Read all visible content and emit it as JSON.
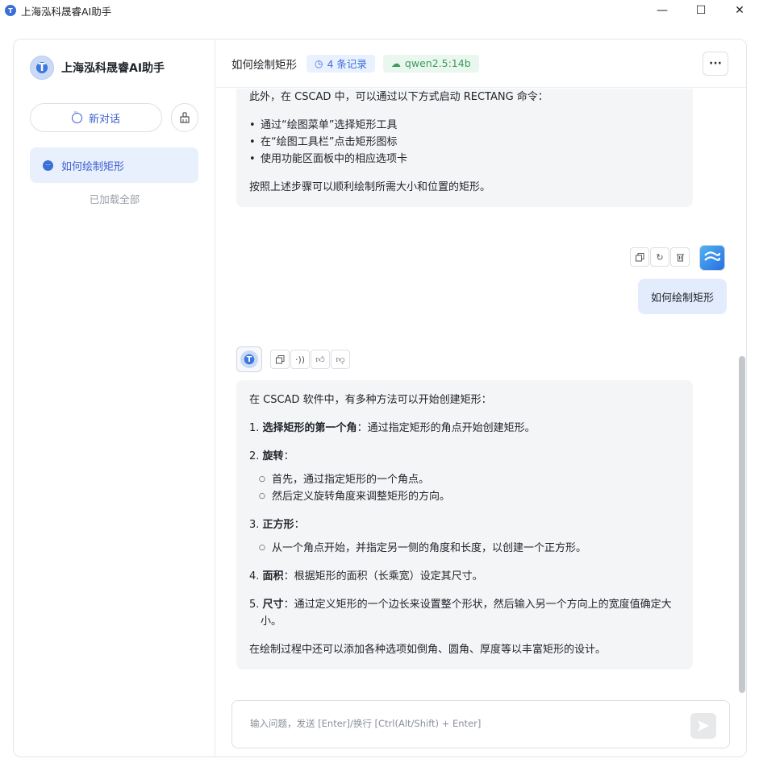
{
  "window": {
    "title": "上海泓科晟睿AI助手",
    "minimize": "—",
    "maximize": "☐",
    "close": "✕"
  },
  "sidebar": {
    "brand_name": "上海泓科晟睿AI助手",
    "new_chat_label": "新对话",
    "sessions": [
      {
        "label": "如何绘制矩形"
      }
    ],
    "loaded_all": "已加载全部"
  },
  "header": {
    "chat_title": "如何绘制矩形",
    "records_label": "4 条记录",
    "model_label": "qwen2.5:14b",
    "more": "···"
  },
  "messages": {
    "ai_prev": {
      "intro": "此外，在 CSCAD 中，可以通过以下方式启动 RECTANG 命令：",
      "bullets": [
        "通过“绘图菜单”选择矩形工具",
        "在“绘图工具栏”点击矩形图标",
        "使用功能区面板中的相应选项卡"
      ],
      "outro": "按照上述步骤可以顺利绘制所需大小和位置的矩形。"
    },
    "user": {
      "text": "如何绘制矩形"
    },
    "ai_last": {
      "intro": "在 CSCAD 软件中，有多种方法可以开始创建矩形：",
      "item1_num": "1.",
      "item1_title": "选择矩形的第一个角",
      "item1_text": "：通过指定矩形的角点开始创建矩形。",
      "item2_num": "2.",
      "item2_title": "旋转",
      "item2_text": "：",
      "item2_sub": [
        "首先，通过指定矩形的一个角点。",
        "然后定义旋转角度来调整矩形的方向。"
      ],
      "item3_num": "3.",
      "item3_title": "正方形",
      "item3_text": "：",
      "item3_sub": [
        "从一个角点开始，并指定另一侧的角度和长度，以创建一个正方形。"
      ],
      "item4_num": "4.",
      "item4_title": "面积",
      "item4_text": "：根据矩形的面积（长乘宽）设定其尺寸。",
      "item5_num": "5.",
      "item5_title": "尺寸",
      "item5_text": "：通过定义矩形的一个边长来设置整个形状，然后输入另一个方向上的宽度值确定大小。",
      "outro": "在绘制过程中还可以添加各种选项如倒角、圆角、厚度等以丰富矩形的设计。"
    }
  },
  "input": {
    "placeholder": "输入问题，发送 [Enter]/换行 [Ctrl(Alt/Shift) + Enter]"
  },
  "colors": {
    "accent": "#3b6fd8",
    "session_bg": "#e8effd",
    "model_green": "#3a9a5a"
  }
}
